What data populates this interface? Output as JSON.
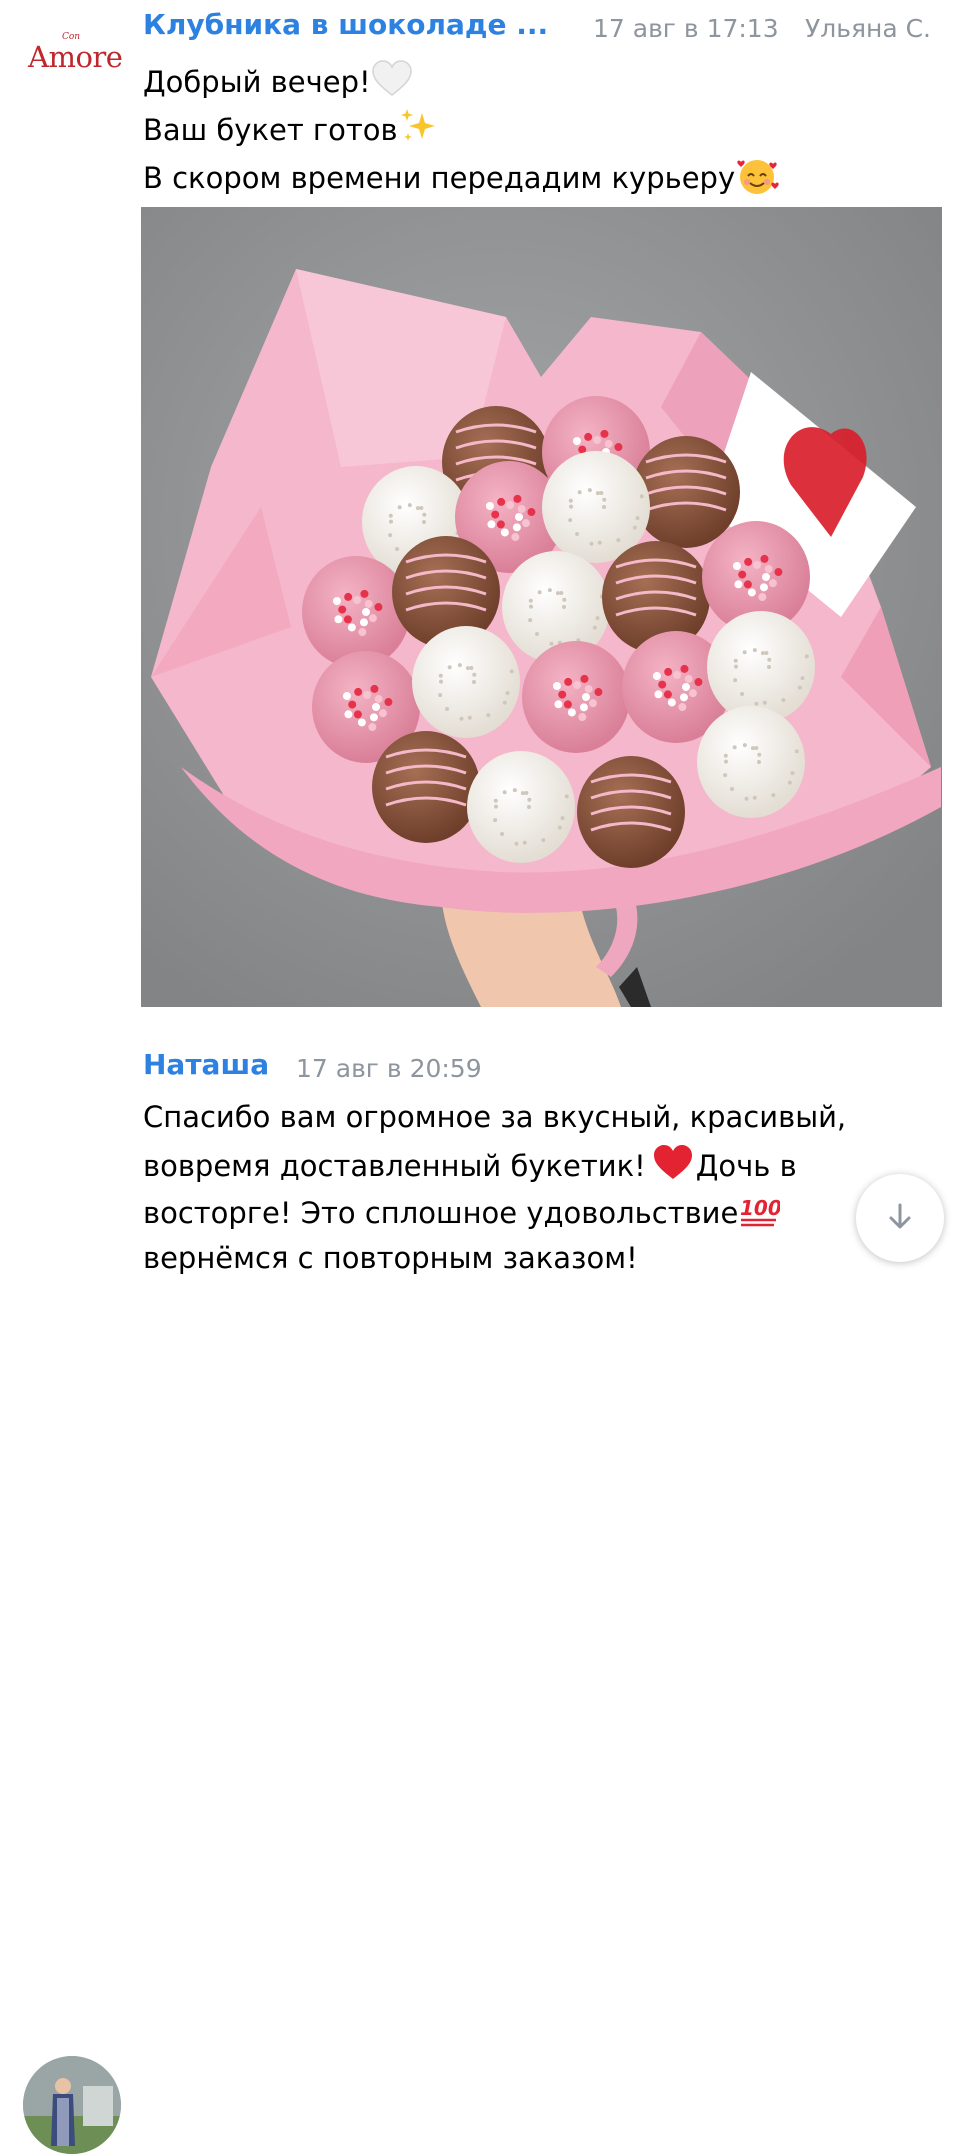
{
  "post": {
    "author": "Клубника в шоколаде ...",
    "date": "17 авг в 17:13",
    "publisher": "Ульяна С.",
    "logo_small": "Con",
    "logo_big": "Amore",
    "lines": [
      "Добрый вечер!",
      "Ваш букет готов",
      "В скором времени передадим курьеру"
    ],
    "emoji": [
      "white-heart-icon",
      "sparkles-icon",
      "smiling-face-with-hearts-icon"
    ]
  },
  "comment": {
    "author": "Наташа",
    "date": "17 авг в 20:59",
    "lines": [
      "Спасибо вам огромное за вкусный, красивый,",
      "вовремя доставленный букетик!",
      "Дочь в",
      "восторге! Это сплошное удовольствие",
      "вернёмся с повторным заказом!"
    ],
    "emoji": [
      "red-heart-icon",
      "hundred-points-icon"
    ]
  },
  "colors": {
    "author": "#2d81e0",
    "meta": "#8e959e",
    "brand": "#c0272d",
    "photo_bg": "#939496",
    "wrap_pink": "#f2adc3"
  }
}
